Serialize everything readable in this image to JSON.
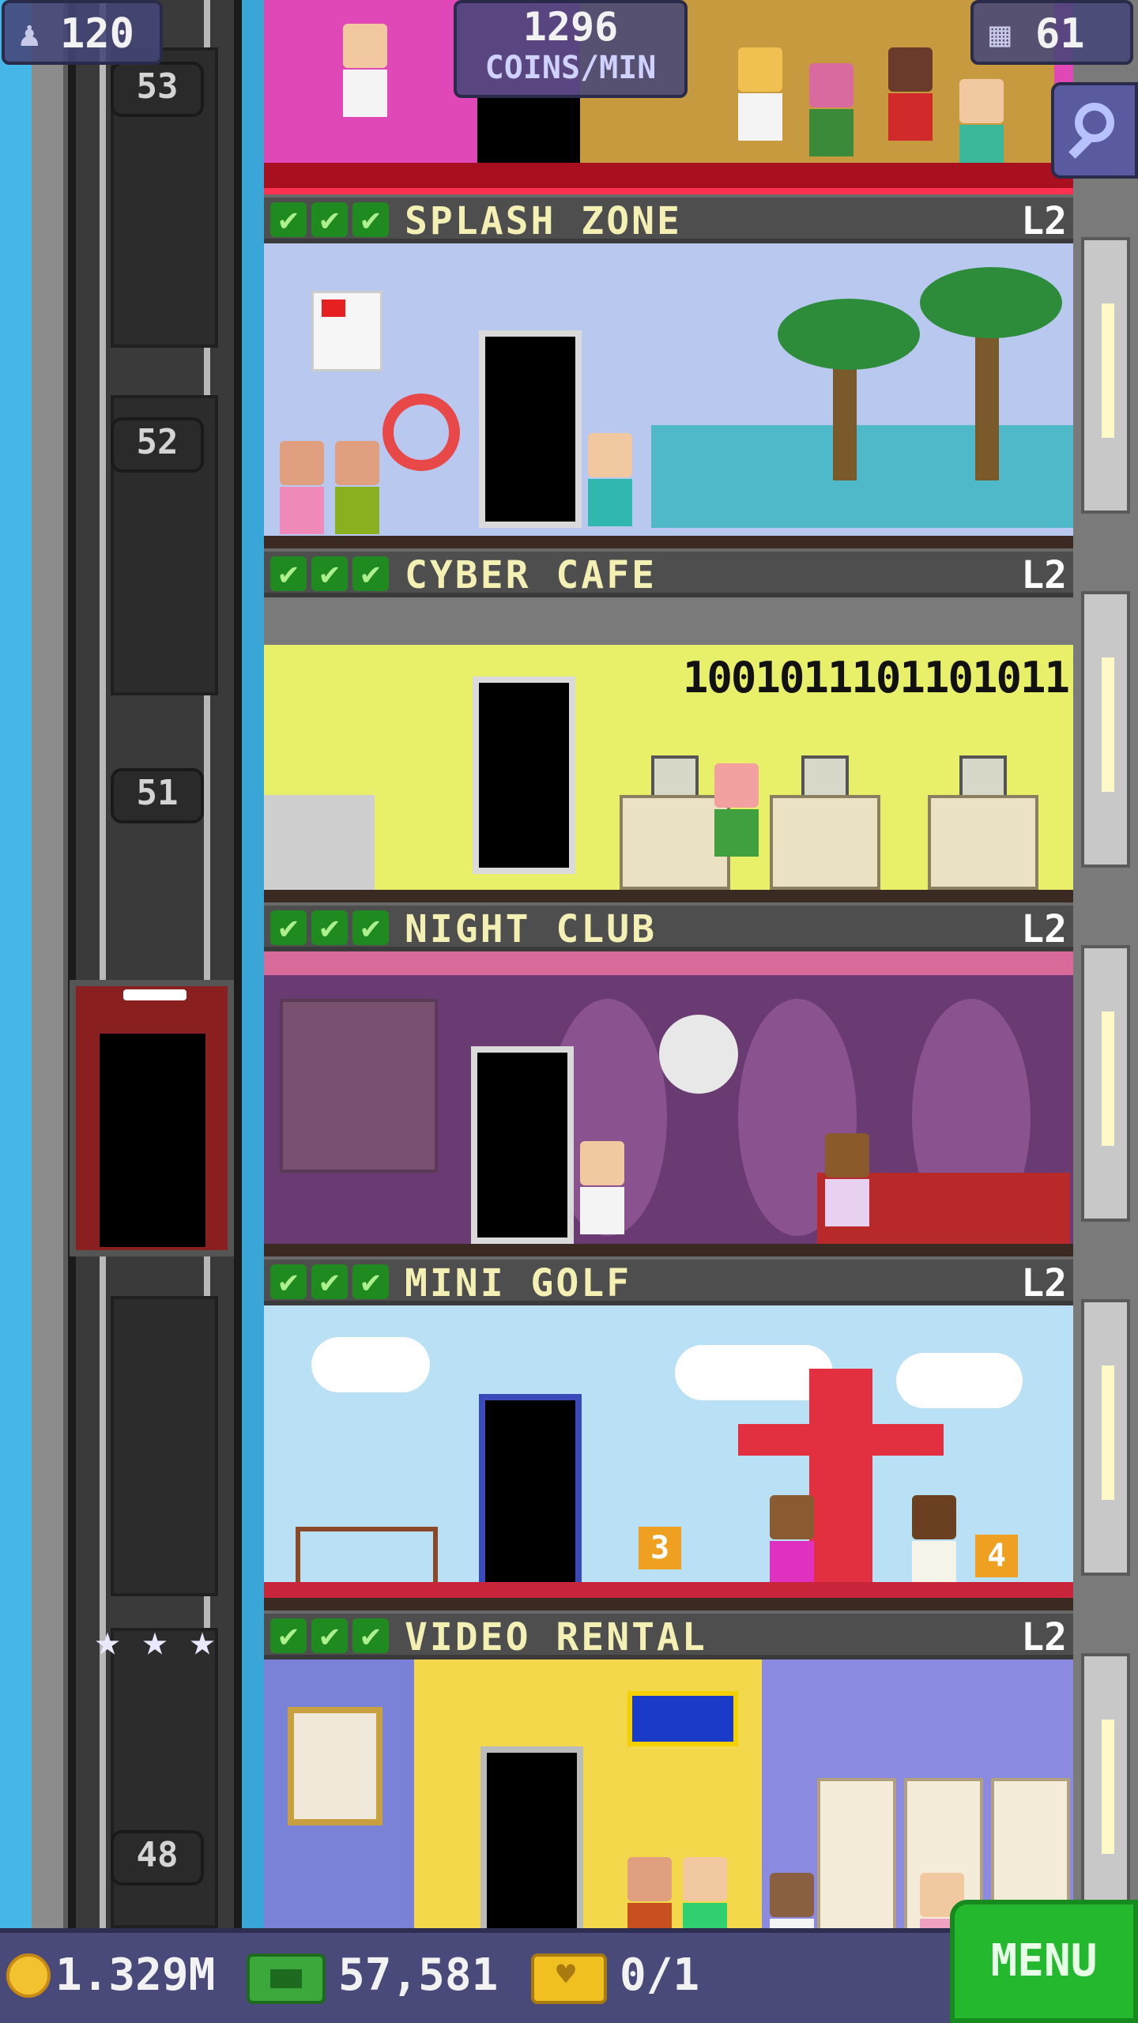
{
  "hud": {
    "population": "120",
    "coins_per_min_value": "1296",
    "coins_per_min_label": "COINS/MIN",
    "floors": "61"
  },
  "elevator": {
    "floor_numbers": [
      "53",
      "52",
      "51",
      "48"
    ],
    "stars": [
      "★",
      "★",
      "★"
    ]
  },
  "floors": [
    {
      "name": "SPLASH ZONE",
      "level": "L2",
      "checks": [
        "✔",
        "✔",
        "✔"
      ]
    },
    {
      "name": "CYBER CAFE",
      "level": "L2",
      "checks": [
        "✔",
        "✔",
        "✔"
      ]
    },
    {
      "name": "NIGHT CLUB",
      "level": "L2",
      "checks": [
        "✔",
        "✔",
        "✔"
      ]
    },
    {
      "name": "MINI GOLF",
      "level": "L2",
      "checks": [
        "✔",
        "✔",
        "✔"
      ]
    },
    {
      "name": "VIDEO RENTAL",
      "level": "L2",
      "checks": [
        "✔",
        "✔",
        "✔"
      ]
    }
  ],
  "room_text": {
    "cyber_binary": "1001011101101011",
    "golf_flag_left": "3",
    "golf_flag_right": "4"
  },
  "bottom_bar": {
    "coins": "1.329M",
    "bux": "57,581",
    "tickets": "0/1",
    "menu_label": "MENU"
  },
  "icons": {
    "population": "person-icon",
    "floors": "building-icon",
    "search": "magnifier-icon",
    "coins": "coin-icon",
    "bux": "bux-icon",
    "tickets": "ticket-icon"
  },
  "colors": {
    "hud_bg": "#46467a",
    "header_text": "#f4f0b4",
    "check_green": "#1f8a1f",
    "menu_green": "#24b82e"
  }
}
